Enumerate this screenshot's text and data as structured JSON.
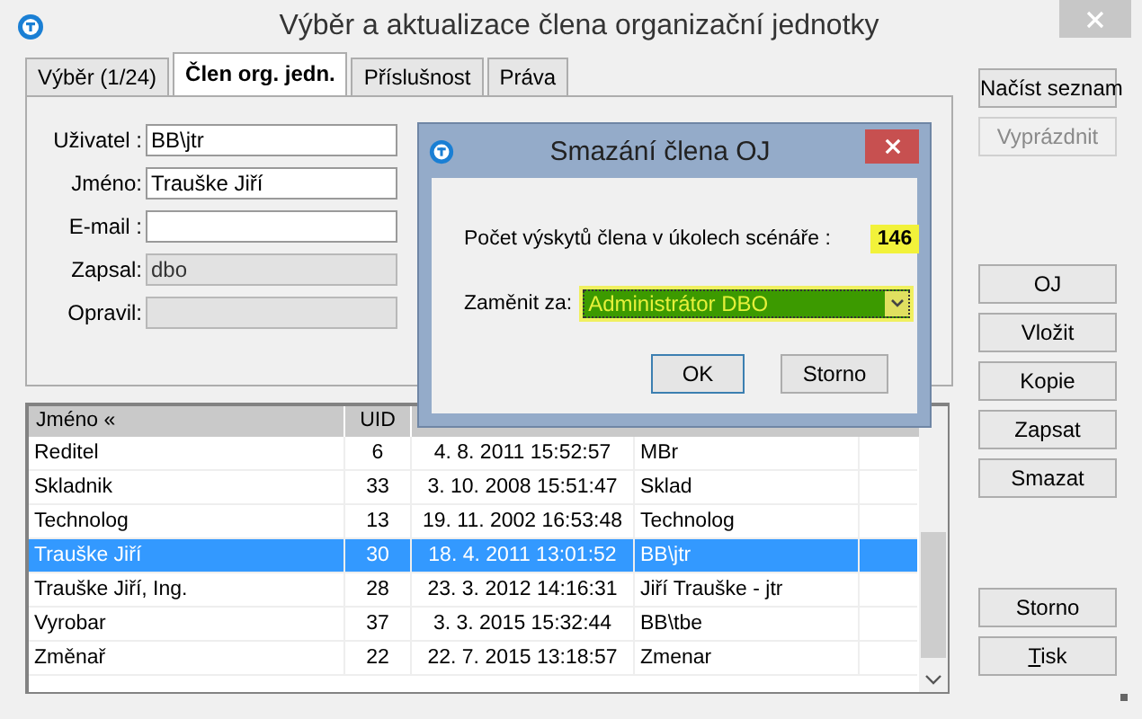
{
  "window": {
    "title": "Výběr a aktualizace člena organizační jednotky"
  },
  "tabs": [
    {
      "label": "Výběr (1/24)",
      "selected": false
    },
    {
      "label": "Člen org. jedn.",
      "selected": true
    },
    {
      "label": "Příslušnost",
      "selected": false
    },
    {
      "label": "Práva",
      "selected": false
    }
  ],
  "form": {
    "fields": [
      {
        "label": "Uživatel :",
        "value": "BB\\jtr",
        "disabled": false
      },
      {
        "label": "Jméno:",
        "value": "Trauške Jiří",
        "disabled": false
      },
      {
        "label": "E-mail :",
        "disabled": false
      },
      {
        "label": "Zapsal:",
        "value": "dbo",
        "disabled": true
      },
      {
        "label": "Opravil:",
        "disabled": true
      }
    ]
  },
  "table": {
    "columns": [
      "Jméno «",
      "UID"
    ],
    "rows": [
      {
        "cells": [
          "Reditel",
          "6",
          "4. 8. 2011 15:52:57",
          "MBr"
        ],
        "selected": false
      },
      {
        "cells": [
          "Skladnik",
          "33",
          "3. 10. 2008 15:51:47",
          "Sklad"
        ],
        "selected": false
      },
      {
        "cells": [
          "Technolog",
          "13",
          "19. 11. 2002 16:53:48",
          "Technolog"
        ],
        "selected": false
      },
      {
        "cells": [
          "Trauške Jiří",
          "30",
          "18. 4. 2011 13:01:52",
          "BB\\jtr"
        ],
        "selected": true
      },
      {
        "cells": [
          "Trauške Jiří, Ing.",
          "28",
          "23. 3. 2012 14:16:31",
          "Jiří Trauške - jtr"
        ],
        "selected": false
      },
      {
        "cells": [
          "Vyrobar",
          "37",
          "3. 3. 2015 15:32:44",
          "BB\\tbe"
        ],
        "selected": false
      },
      {
        "cells": [
          "Změnař",
          "22",
          "22. 7. 2015 13:18:57",
          "Zmenar"
        ],
        "selected": false
      }
    ]
  },
  "side_button_groups": [
    [
      {
        "label": "Načíst seznam",
        "disabled": false
      },
      {
        "label": "Vyprázdnit",
        "disabled": true
      }
    ],
    [
      {
        "label": "OJ",
        "disabled": false
      },
      {
        "label": "Vložit",
        "disabled": false
      },
      {
        "label": "Kopie",
        "disabled": false
      },
      {
        "label": "Zapsat",
        "disabled": false
      },
      {
        "label": "Smazat",
        "disabled": false
      }
    ],
    [
      {
        "label": "Storno",
        "disabled": false
      },
      {
        "underlined": "T",
        "label": "isk",
        "disabled": false
      }
    ]
  ],
  "dialog": {
    "title": "Smazání člena OJ",
    "count_label": "Počet výskytů člena v úkolech scénáře :",
    "count": "146",
    "replace_label": "Zaměnit za:",
    "replace_value": "Administrátor DBO",
    "buttons": [
      "OK",
      "Storno"
    ]
  }
}
